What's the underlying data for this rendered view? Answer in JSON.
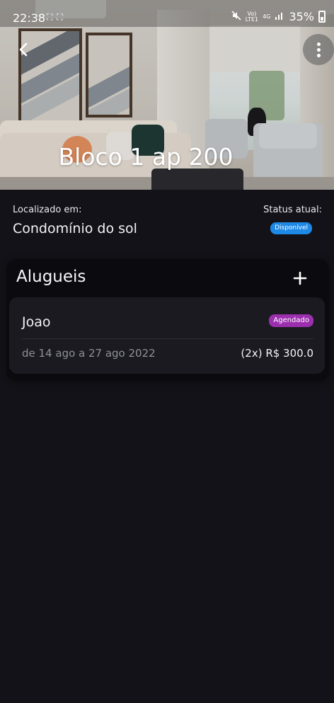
{
  "status_bar": {
    "time": "22:38",
    "extra_icons": "⛶ ⛶",
    "network_top": "Vo)",
    "network_bottom": "LTE1",
    "network_type": "4G",
    "battery": "35%"
  },
  "header": {
    "title": "Bloco 1 ap 200",
    "back_icon": "chevron-left-icon",
    "more_icon": "more-vertical-icon"
  },
  "info": {
    "location_label": "Localizado em:",
    "location_value": "Condomínio do sol",
    "status_label": "Status atual:",
    "status_value": "Disponível",
    "status_color": "#1e88e5"
  },
  "rentals": {
    "title": "Alugueis",
    "add_icon": "plus-icon",
    "items": [
      {
        "tenant": "Joao",
        "status": "Agendado",
        "status_color": "#9b2fae",
        "dates": "de 14 ago a 27 ago 2022",
        "price": "(2x) R$ 300.0"
      }
    ]
  },
  "colors": {
    "background": "#121218",
    "card": "#0b0b0f",
    "item": "#1a1a20"
  }
}
